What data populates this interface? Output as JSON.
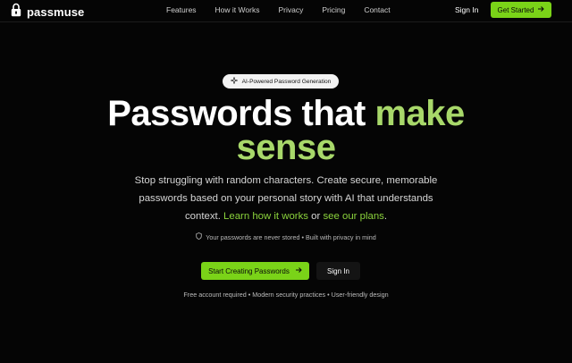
{
  "nav": {
    "brand": "passmuse",
    "links": [
      "Features",
      "How it Works",
      "Privacy",
      "Pricing",
      "Contact"
    ],
    "signin": "Sign In",
    "cta": "Get Started",
    "cta_icon": "arrow-right-icon",
    "logo_icon": "padlock-icon"
  },
  "hero": {
    "badge": "AI-Powered Password Generation",
    "badge_icon": "sparkle-icon",
    "headline_main": "Passwords that ",
    "headline_accent1": "make",
    "headline_accent2": "sense",
    "sub_text": "Stop struggling with random characters. Create secure, memorable passwords based on your personal story with AI that understands context. ",
    "sub_link1": "Learn how it works",
    "sub_or": " or ",
    "sub_link2": "see our plans",
    "sub_end": ".",
    "privacy_note": "Your passwords are never stored • Built with privacy in mind",
    "privacy_icon": "shield-icon",
    "primary_cta": "Start Creating Passwords",
    "secondary_cta": "Sign In",
    "footnote": "Free account required • Modern security practices • User-friendly design"
  },
  "colors": {
    "accent": "#7ad318",
    "accent_text": "#a8d86a",
    "link": "#8bd33c",
    "background": "#050505"
  }
}
